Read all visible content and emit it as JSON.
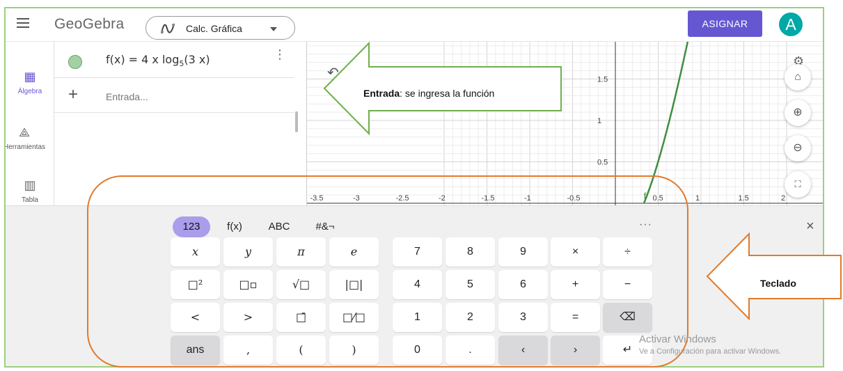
{
  "header": {
    "logo": "GeoGebra",
    "app_selector_label": "Calc. Gráfica",
    "assign_button": "ASIGNAR",
    "avatar_letter": "A"
  },
  "toolbar": {
    "algebra": "Álgebra",
    "tools": "Herramientas",
    "table": "Tabla"
  },
  "algebra": {
    "function_text": "f(x) = 4 x log",
    "function_sub": "5",
    "function_tail": "(3 x)",
    "input_placeholder": "Entrada..."
  },
  "graph": {
    "x_ticks": [
      "-3.5",
      "-3",
      "-2.5",
      "-2",
      "-1.5",
      "-1",
      "-0.5",
      "0.5",
      "1",
      "1.5",
      "2"
    ],
    "y_ticks": [
      "0.5",
      "1",
      "1.5"
    ],
    "curve_label": "f",
    "curve_color": "#3f8e3f"
  },
  "annotations": {
    "entrada_bold": "Entrada",
    "entrada_rest": ": se ingresa la función",
    "teclado": "Teclado"
  },
  "keyboard": {
    "tabs": [
      "123",
      "f(x)",
      "ABC",
      "#&¬"
    ],
    "more": "···",
    "close": "×",
    "rows": [
      [
        "x",
        "y",
        "π",
        "e",
        "7",
        "8",
        "9",
        "×",
        "÷"
      ],
      [
        "□²",
        "□▫",
        "√□",
        "|□|",
        "4",
        "5",
        "6",
        "+",
        "−"
      ],
      [
        "<",
        ">",
        "□̄",
        "□⁄□",
        "1",
        "2",
        "3",
        "=",
        "⌫"
      ],
      [
        "ans",
        ",",
        "(",
        ")",
        "0",
        ".",
        "‹",
        "›",
        "↵"
      ]
    ]
  },
  "watermark": {
    "title": "Activar Windows",
    "subtitle": "Ve a Configuración para activar Windows."
  }
}
